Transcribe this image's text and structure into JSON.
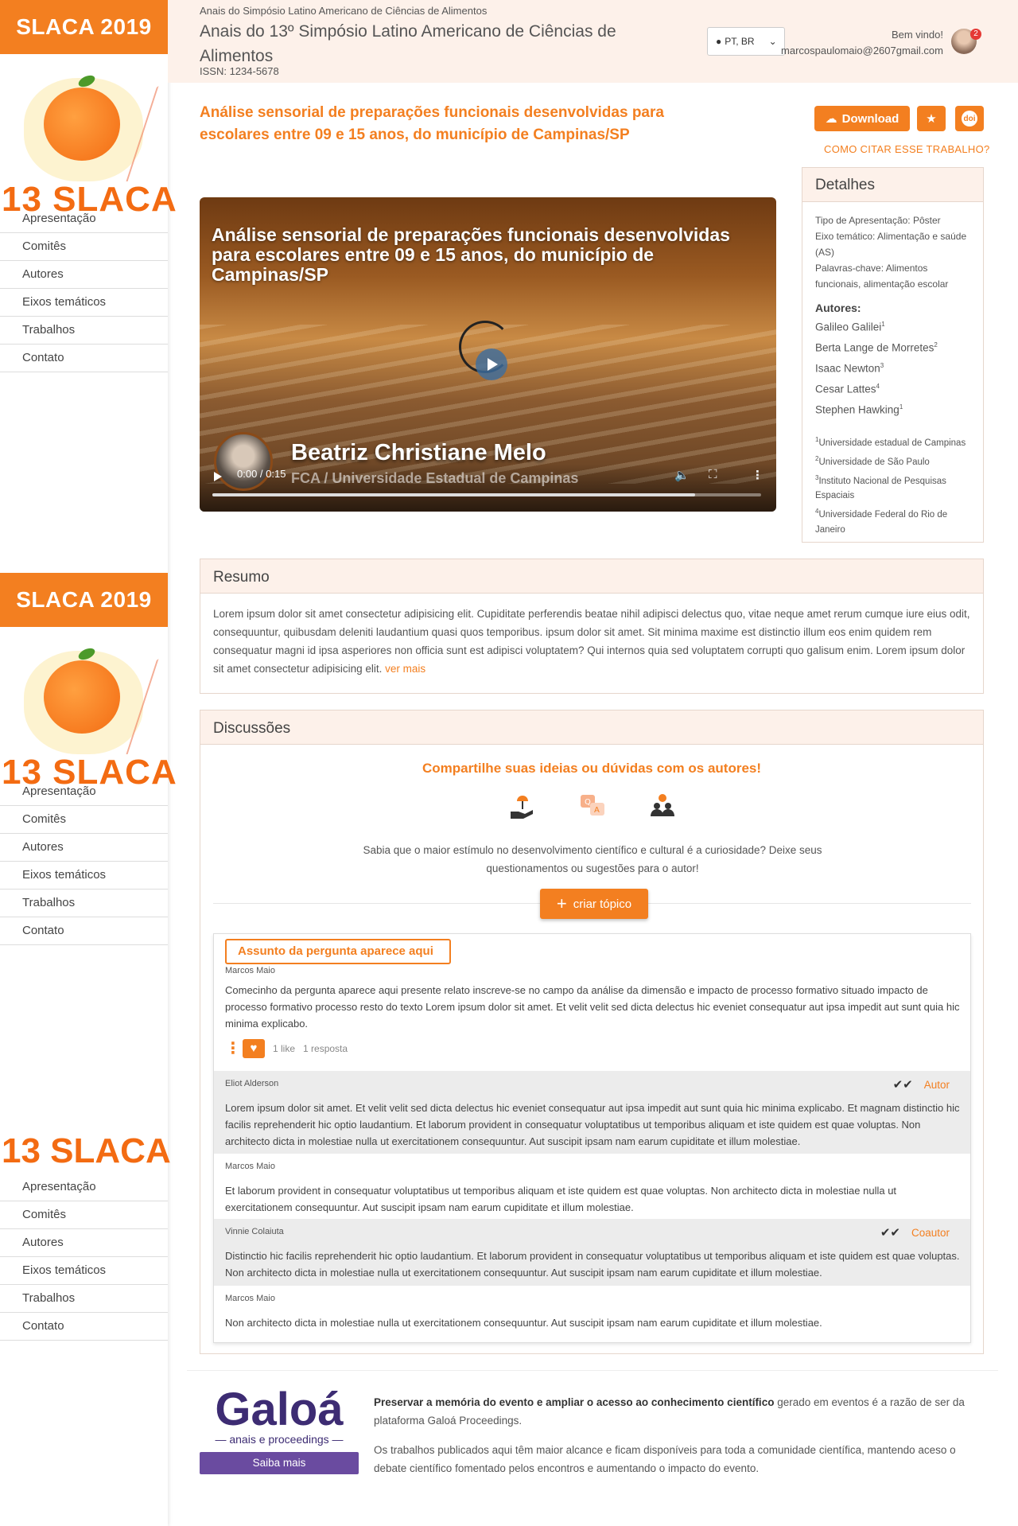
{
  "sidebar": {
    "brand": "SLACA 2019",
    "logo_text": "13 SLACA",
    "nav": [
      "Apresentação",
      "Comitês",
      "Autores",
      "Eixos temáticos",
      "Trabalhos",
      "Contato"
    ]
  },
  "header": {
    "small_title": "Anais do Simpósio Latino Americano de Ciências de Alimentos",
    "title": "Anais do 13º Simpósio Latino Americano de Ciências de Alimentos",
    "issn": "ISSN: 1234-5678",
    "language": "PT, BR",
    "welcome": "Bem vindo!",
    "email": "marcospaulomaio@2607gmail.com",
    "notifications": "2"
  },
  "paper": {
    "title": "Análise sensorial de preparações funcionais desenvolvidas para escolares entre 09 e 15 anos, do município de Campinas/SP",
    "download_label": "Download",
    "star_icon": "★",
    "doi_label": "doi",
    "cite_link": "COMO CITAR ESSE TRABALHO?"
  },
  "video": {
    "title": "Análise sensorial de preparações funcionais desenvolvidas para escolares entre 09 e 15 anos, do município de Campinas/SP",
    "speaker": "Beatriz Christiane Melo",
    "institution": "FCA / Universidade Estadual de Campinas",
    "time": "0:00 / 0:15",
    "progress": 0.88
  },
  "details": {
    "heading": "Detalhes",
    "tipo_label": "Tipo de Apresentação:",
    "tipo_value": "Pôster",
    "eixo_label": "Eixo temático:",
    "eixo_value": "Alimentação e saúde (AS)",
    "palavras_label": "Palavras-chave:",
    "palavras_value": "Alimentos funcionais, alimentação escolar",
    "autores_label": "Autores:",
    "authors": [
      {
        "name": "Galileo Galilei",
        "sup": "1"
      },
      {
        "name": "Berta Lange de Morretes",
        "sup": "2"
      },
      {
        "name": "Isaac Newton",
        "sup": "3"
      },
      {
        "name": "Cesar Lattes",
        "sup": "4"
      },
      {
        "name": "Stephen Hawking",
        "sup": "1"
      }
    ],
    "affiliations": [
      {
        "sup": "1",
        "name": "Universidade estadual de Campinas"
      },
      {
        "sup": "2",
        "name": "Universidade de São Paulo"
      },
      {
        "sup": "3",
        "name": "Instituto Nacional de Pesquisas Espaciais"
      },
      {
        "sup": "4",
        "name": "Universidade Federal do Rio de Janeiro"
      }
    ]
  },
  "resumo": {
    "heading": "Resumo",
    "text": "Lorem ipsum dolor sit amet consectetur adipisicing elit. Cupiditate perferendis beatae nihil adipisci delectus quo, vitae neque amet rerum cumque iure eius odit, consequuntur, quibusdam deleniti laudantium quasi quos temporibus. ipsum dolor sit amet. Sit minima maxime est distinctio illum eos enim quidem rem consequatur magni id ipsa asperiores non officia sunt est adipisci voluptatem? Qui internos quia sed voluptatem corrupti quo galisum enim. Lorem ipsum dolor sit amet consectetur adipisicing elit.",
    "more": "ver mais"
  },
  "discussoes": {
    "heading": "Discussões",
    "share": "Compartilhe suas ideias ou dúvidas com os autores!",
    "info": "Sabia que o maior estímulo no desenvolvimento científico e cultural é a curiosidade? Deixe seus questionamentos ou sugestões para o autor!",
    "create": "criar tópico",
    "thread": {
      "subject": "Assunto da pergunta aparece aqui",
      "author": "Marcos Maio",
      "text": "Comecinho da pergunta aparece aqui presente relato inscreve-se no campo da análise da dimensão e impacto de processo formativo situado impacto de processo formativo processo resto do texto Lorem ipsum dolor sit amet. Et velit velit sed dicta delectus hic eveniet consequatur aut ipsa impedit aut sunt quia hic minima explicabo.",
      "likes": "1 like",
      "replies_count": "1 resposta",
      "replies": [
        {
          "author": "Eliot Alderson",
          "tag": "Autor",
          "text": "Lorem ipsum dolor sit amet. Et velit velit sed dicta delectus hic eveniet consequatur aut ipsa impedit aut sunt quia hic minima explicabo. Et magnam distinctio hic facilis reprehenderit hic optio laudantium. Et laborum provident in consequatur voluptatibus ut temporibus aliquam et iste quidem est quae voluptas. Non architecto dicta in molestiae nulla ut exercitationem consequuntur. Aut suscipit ipsam nam earum cupiditate et illum molestiae."
        },
        {
          "author": "Marcos Maio",
          "tag": "",
          "text": "Et laborum provident in consequatur voluptatibus ut temporibus aliquam et iste quidem est quae voluptas. Non architecto dicta in molestiae nulla ut exercitationem consequuntur. Aut suscipit ipsam nam earum cupiditate et illum molestiae."
        },
        {
          "author": "Vinnie Colaiuta",
          "tag": "Coautor",
          "text": "Distinctio hic facilis reprehenderit hic optio laudantium. Et laborum provident in consequatur voluptatibus ut temporibus aliquam et iste quidem est quae voluptas. Non architecto dicta in molestiae nulla ut exercitationem consequuntur. Aut suscipit ipsam nam earum cupiditate et illum molestiae."
        },
        {
          "author": "Marcos Maio",
          "tag": "",
          "text": "Non architecto dicta in molestiae nulla ut exercitationem consequuntur. Aut suscipit ipsam nam earum cupiditate et illum molestiae."
        }
      ]
    }
  },
  "footer": {
    "brand": "Galoá",
    "brand_sub": "anais e proceedings",
    "cta": "Saiba mais",
    "p1_bold": "Preservar a memória do evento e ampliar o acesso ao conhecimento científico",
    "p1_rest": " gerado em eventos é a razão de ser da plataforma Galoá Proceedings.",
    "p2": "Os trabalhos publicados aqui têm maior alcance e ficam disponíveis para toda a comunidade científica, mantendo aceso o debate científico fomentado pelos encontros e aumentando o impacto do evento."
  },
  "colors": {
    "accent": "#f37f20",
    "header_bg": "#fdf1ea",
    "galoa": "#3d2c73"
  }
}
